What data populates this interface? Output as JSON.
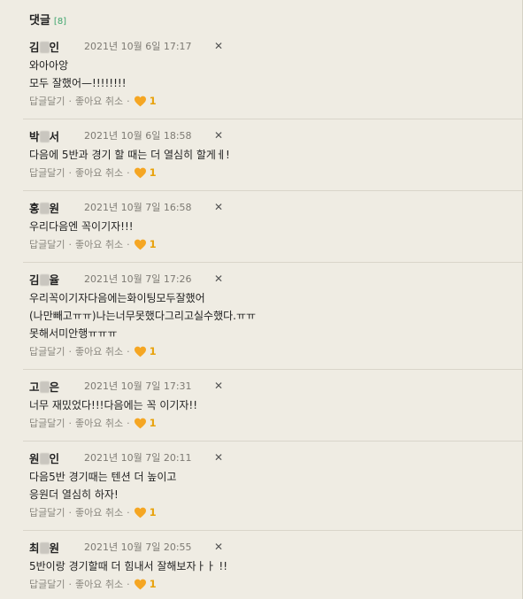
{
  "header": {
    "title": "댓글",
    "count": "[8]"
  },
  "labels": {
    "reply": "답글달기",
    "like_cancel": "좋아요 취소",
    "separator": "·",
    "close": "✕"
  },
  "colors": {
    "heart": "#f5a623",
    "count": "#3fa66e"
  },
  "comments": [
    {
      "author_first": "김",
      "author_last": "인",
      "time": "2021년 10월 6일 17:17",
      "text": "와아아앙\n모두 잘했어—!!!!!!!!",
      "likes": "1"
    },
    {
      "author_first": "박",
      "author_last": "서",
      "time": "2021년 10월 6일 18:58",
      "text": "다음에 5반과 경기 할 때는 더 열심히 할게ㅔ!",
      "likes": "1"
    },
    {
      "author_first": "홍",
      "author_last": "원",
      "time": "2021년 10월 7일 16:58",
      "text": "우리다음엔 꼭이기자!!!",
      "likes": "1"
    },
    {
      "author_first": "김",
      "author_last": "율",
      "time": "2021년 10월 7일 17:26",
      "text": "우리꼭이기자다음에는화이팅모두잘했어\n(나만빼고ㅠㅠ)나는너무못했다그리고실수했다.ㅠㅠ\n못해서미안행ㅠㅠㅠ",
      "likes": "1"
    },
    {
      "author_first": "고",
      "author_last": "은",
      "time": "2021년 10월 7일 17:31",
      "text": "너무 재밌었다!!!다음에는 꼭 이기자!!",
      "likes": "1"
    },
    {
      "author_first": "원",
      "author_last": "인",
      "time": "2021년 10월 7일 20:11",
      "text": "다음5반 경기때는 텐션 더 높이고\n응원더 열심히 하자!",
      "likes": "1"
    },
    {
      "author_first": "최",
      "author_last": "원",
      "time": "2021년 10월 7일 20:55",
      "text": "5반이랑 경기할때 더 힘내서 잘해보자ㅏㅏ !!",
      "likes": "1"
    }
  ]
}
